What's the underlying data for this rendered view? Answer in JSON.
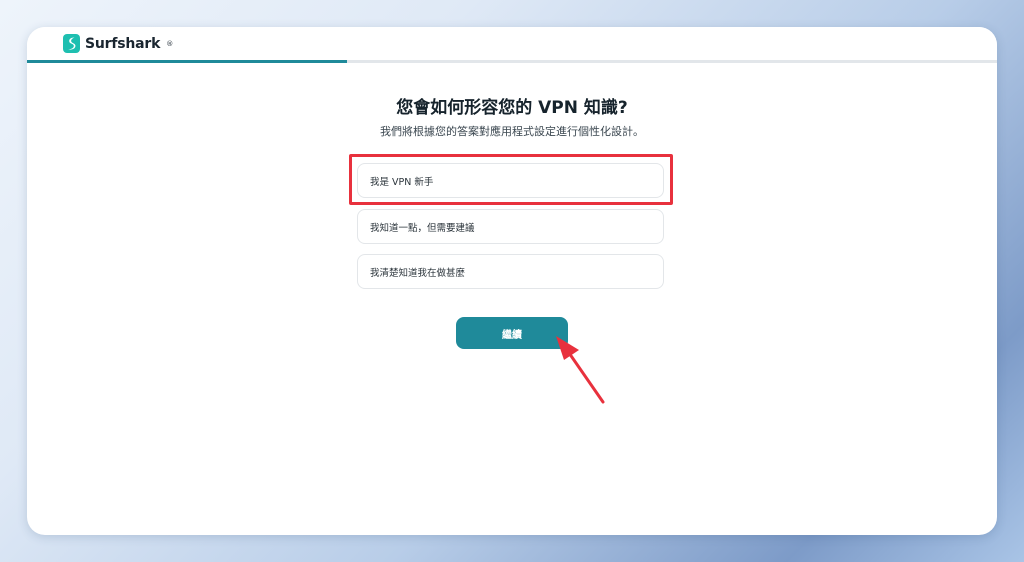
{
  "app": {
    "brand": "Surfshark",
    "brand_mark": "®"
  },
  "progress": {
    "fraction": 0.33
  },
  "question": {
    "title": "您會如何形容您的 VPN 知識?",
    "subtitle": "我們將根據您的答案對應用程式設定進行個性化設計。"
  },
  "options": [
    {
      "label": "我是 VPN 新手"
    },
    {
      "label": "我知道一點，但需要建議"
    },
    {
      "label": "我清楚知道我在做甚麼"
    }
  ],
  "actions": {
    "continue_label": "繼續"
  },
  "colors": {
    "accent": "#1f8a9a",
    "brand_mark": "#1ebfb0",
    "highlight": "#e8313d"
  },
  "icons": {
    "logo": "surfshark-logo-icon",
    "annotation": "red-arrow-icon"
  }
}
